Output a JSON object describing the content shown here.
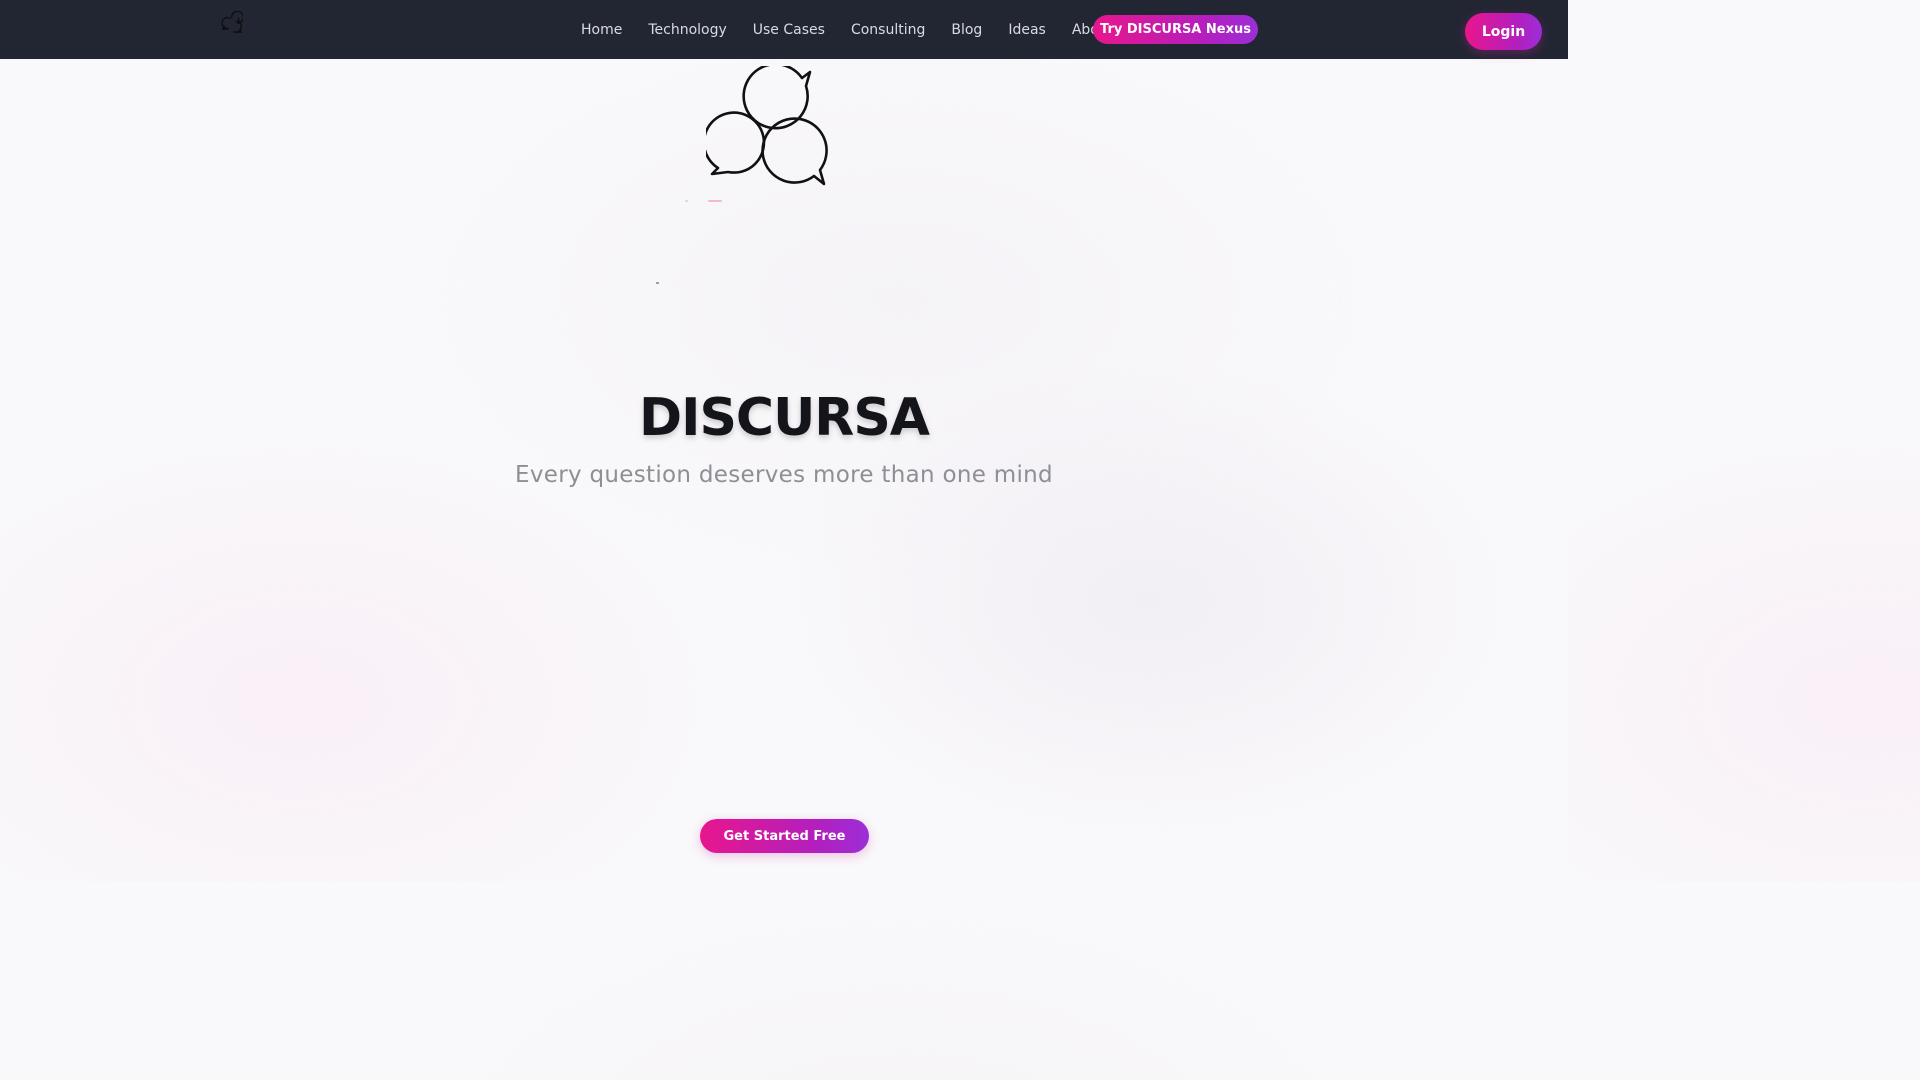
{
  "nav": {
    "logo_icon": "speech-bubbles-logo-icon",
    "links": [
      "Home",
      "Technology",
      "Use Cases",
      "Consulting",
      "Blog",
      "Ideas",
      "About"
    ],
    "cta_label": "Try DISCURSA Nexus",
    "login_label": "Login"
  },
  "hero": {
    "logo_icon": "speech-bubbles-logo-icon",
    "title": "DISCURSA",
    "subtitle": "Every question deserves more than one mind",
    "cta_label": "Get Started Free"
  },
  "colors": {
    "navbar_bg": "#222633",
    "accent_start": "#e8168c",
    "accent_end": "#9b2fd6",
    "title_text": "#14151a",
    "subtitle_text": "#8d8f95"
  }
}
